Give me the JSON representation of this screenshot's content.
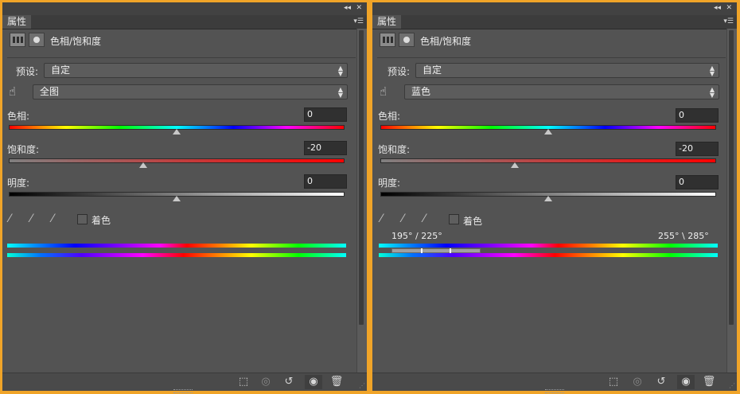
{
  "colors": {
    "bg": "#f0a428",
    "panel": "#535353"
  },
  "left": {
    "tab": "属性",
    "title": "色相/饱和度",
    "preset": {
      "label": "预设:",
      "value": "自定"
    },
    "range_select": "全图",
    "hue": {
      "label": "色相:",
      "value": "0",
      "position": 0.5
    },
    "saturation": {
      "label": "饱和度:",
      "value": "-20",
      "position": 0.4
    },
    "lightness": {
      "label": "明度:",
      "value": "0",
      "position": 0.5
    },
    "colorize": "着色"
  },
  "right": {
    "tab": "属性",
    "title": "色相/饱和度",
    "preset": {
      "label": "预设:",
      "value": "自定"
    },
    "range_select": "蓝色",
    "hue": {
      "label": "色相:",
      "value": "0",
      "position": 0.5
    },
    "saturation": {
      "label": "饱和度:",
      "value": "-20",
      "position": 0.4
    },
    "lightness": {
      "label": "明度:",
      "value": "0",
      "position": 0.5
    },
    "colorize": "着色",
    "range_left": "195° / 225°",
    "range_right": "255° \\ 285°"
  },
  "icons": {
    "collapse": "double-chevron-left-icon",
    "close": "close-icon",
    "menu": "panel-menu-icon",
    "adjustment": "adjustment-layer-icon",
    "mask": "mask-icon",
    "hand": "targeted-adjust-hand-icon",
    "eyedropper": "eyedropper-icon",
    "clip": "clip-to-layer-icon",
    "view_prev": "view-previous-state-icon",
    "reset": "reset-icon",
    "visibility": "eye-icon",
    "delete": "trash-icon"
  }
}
